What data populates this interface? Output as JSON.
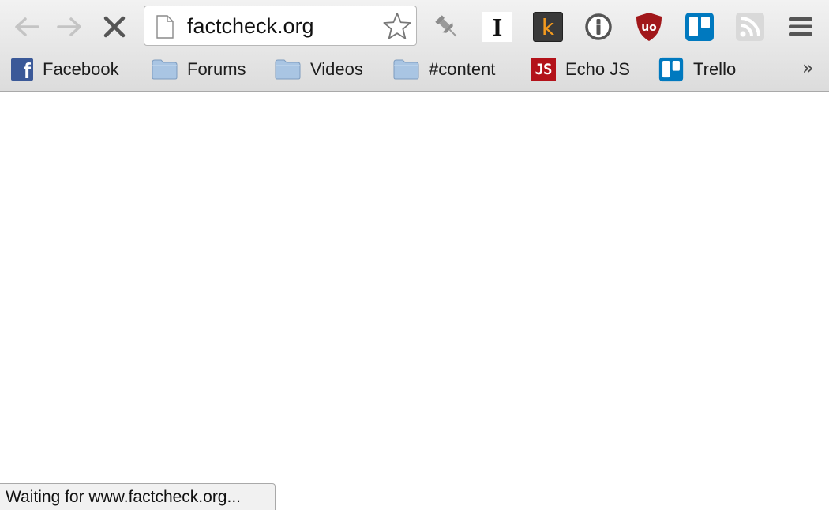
{
  "browser": {
    "address_bar": {
      "url": "factcheck.org"
    },
    "navigation": {
      "back_icon": "arrow-left",
      "forward_icon": "arrow-right",
      "stop_icon": "stop-x"
    },
    "extensions": [
      {
        "name": "pin-icon"
      },
      {
        "name": "instapaper-icon",
        "glyph": "I"
      },
      {
        "name": "kippt-icon",
        "glyph": "k"
      },
      {
        "name": "onepassword-icon"
      },
      {
        "name": "ublock-icon",
        "glyph": "uo"
      },
      {
        "name": "trello-icon"
      },
      {
        "name": "rss-icon"
      }
    ],
    "menu_icon": "hamburger-menu",
    "bookmarks": [
      {
        "label": "Facebook",
        "icon": "facebook-icon",
        "glyph": "f"
      },
      {
        "label": "Forums",
        "icon": "folder-icon"
      },
      {
        "label": "Videos",
        "icon": "folder-icon"
      },
      {
        "label": "#content",
        "icon": "folder-icon"
      },
      {
        "label": "Echo JS",
        "icon": "echojs-icon",
        "glyph": "JS"
      },
      {
        "label": "Trello",
        "icon": "trello-icon"
      }
    ],
    "bookmarks_overflow": "»",
    "status_text": "Waiting for www.factcheck.org..."
  },
  "colors": {
    "facebook": "#3b5998",
    "echojs": "#b3121a",
    "trello": "#0079bf",
    "ublock": "#a1171a",
    "kippt_bg": "#3a3a3a",
    "kippt_fg": "#f39a1e",
    "folder": "#8fb3d9"
  }
}
